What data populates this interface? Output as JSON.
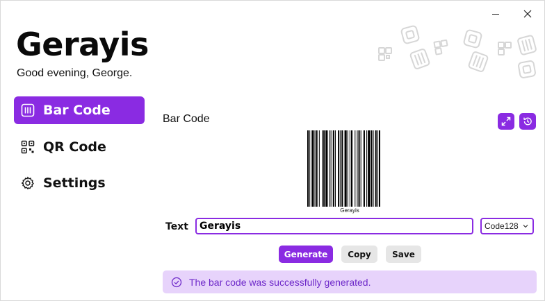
{
  "app": {
    "title": "Gerayis",
    "greeting": "Good evening, George."
  },
  "colors": {
    "accent": "#8a2be2",
    "status_bg": "#e7d3fb",
    "status_text": "#6d28c9"
  },
  "sidebar": {
    "items": [
      {
        "label": "Bar Code",
        "icon": "barcode-icon",
        "active": true
      },
      {
        "label": "QR Code",
        "icon": "qr-code-icon",
        "active": false
      },
      {
        "label": "Settings",
        "icon": "gear-icon",
        "active": false
      }
    ]
  },
  "main": {
    "section_title": "Bar Code",
    "barcode_caption": "Gerayis",
    "text_label": "Text",
    "text_value": "Gerayis",
    "format": "Code128",
    "buttons": {
      "generate": "Generate",
      "copy": "Copy",
      "save": "Save"
    },
    "status": "The bar code was successfully generated."
  }
}
